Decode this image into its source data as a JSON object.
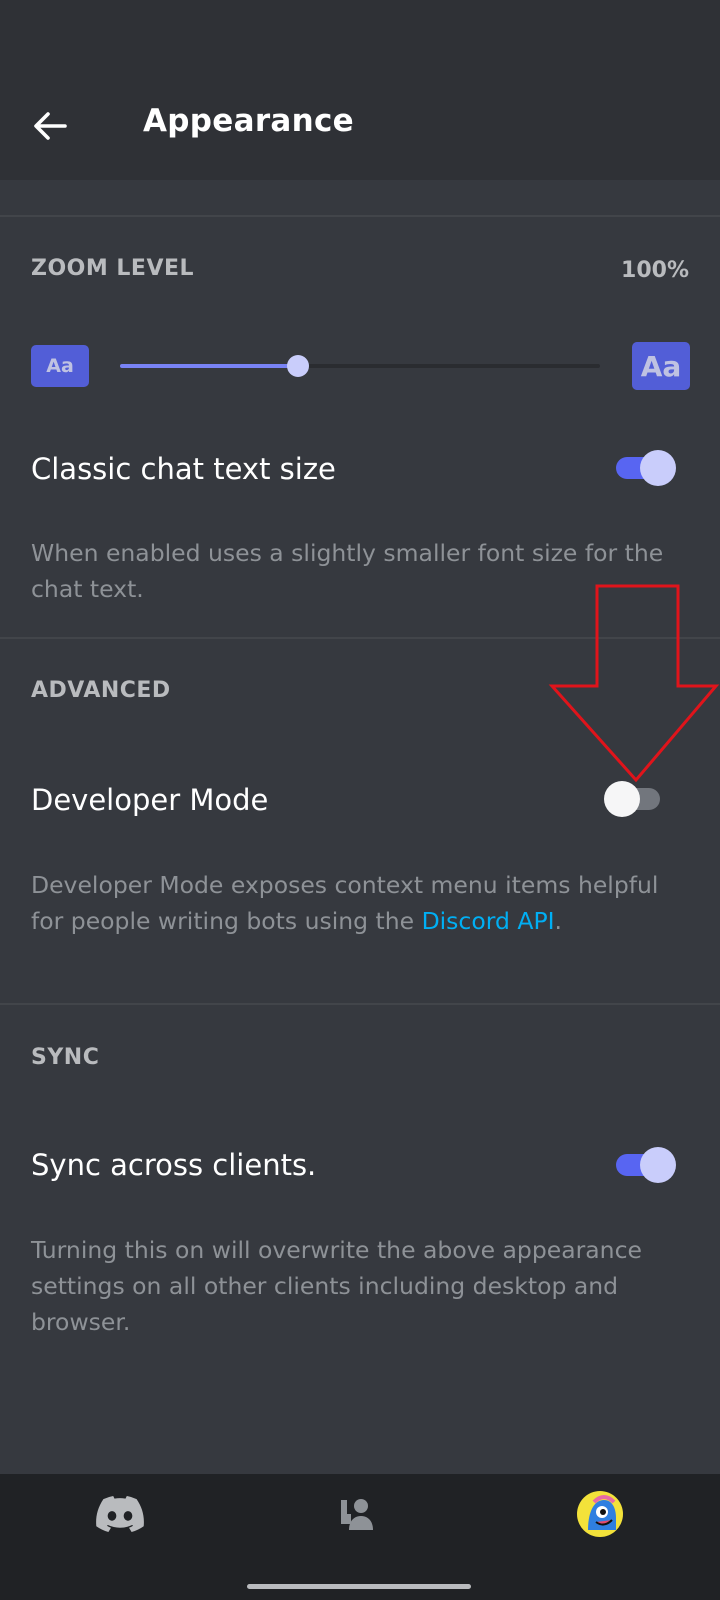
{
  "header": {
    "title": "Appearance",
    "back_icon": "arrow-left-icon"
  },
  "zoom": {
    "section_title": "ZOOM LEVEL",
    "value_text": "100%",
    "small_badge": "Aa",
    "large_badge": "Aa",
    "slider_fraction": 0.37
  },
  "classic_text": {
    "label": "Classic chat text size",
    "description": "When enabled uses a slightly smaller font size for the chat text.",
    "enabled": true
  },
  "advanced": {
    "section_title": "ADVANCED",
    "developer_mode": {
      "label": "Developer Mode",
      "description_prefix": "Developer Mode exposes context menu items helpful for people writing bots using the ",
      "link_text": "Discord API",
      "description_suffix": ".",
      "enabled": false
    }
  },
  "sync": {
    "section_title": "SYNC",
    "label": "Sync across clients.",
    "description": "Turning this on will overwrite the above appearance settings on all other clients including desktop and browser.",
    "enabled": true
  },
  "bottom_nav": {
    "items": [
      {
        "icon": "discord-home-icon"
      },
      {
        "icon": "friends-icon"
      },
      {
        "icon": "user-avatar-icon"
      }
    ]
  },
  "colors": {
    "background": "#36393f",
    "header": "#2f3136",
    "accent": "#5865f2",
    "link": "#00aff4",
    "annotation_arrow": "#e0141b"
  }
}
